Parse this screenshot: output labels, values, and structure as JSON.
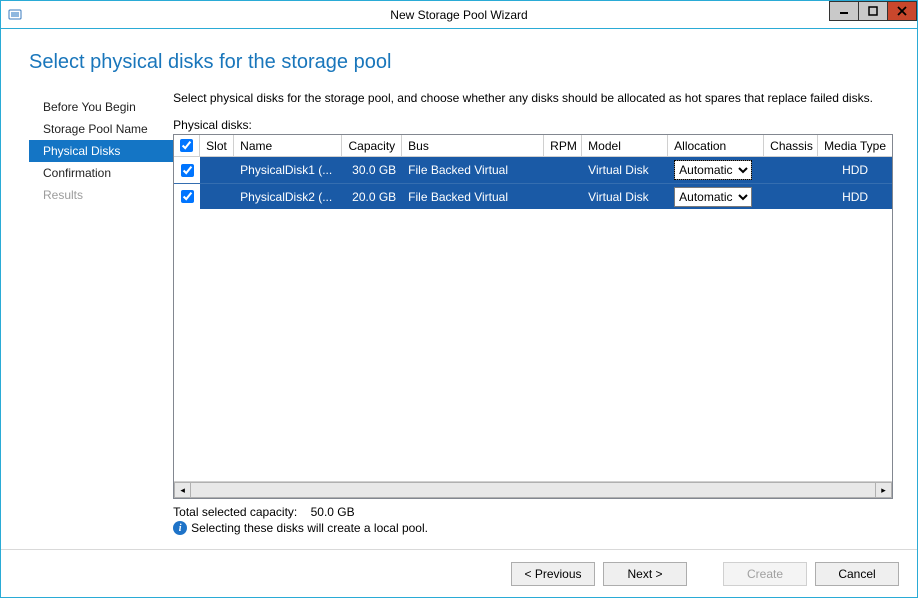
{
  "window": {
    "title": "New Storage Pool Wizard"
  },
  "page_title": "Select physical disks for the storage pool",
  "sidebar": {
    "items": [
      {
        "label": "Before You Begin",
        "active": false,
        "disabled": false
      },
      {
        "label": "Storage Pool Name",
        "active": false,
        "disabled": false
      },
      {
        "label": "Physical Disks",
        "active": true,
        "disabled": false
      },
      {
        "label": "Confirmation",
        "active": false,
        "disabled": false
      },
      {
        "label": "Results",
        "active": false,
        "disabled": true
      }
    ]
  },
  "instruction": "Select physical disks for the storage pool, and choose whether any disks should be allocated as hot spares that replace failed disks.",
  "table": {
    "label": "Physical disks:",
    "columns": [
      "",
      "Slot",
      "Name",
      "Capacity",
      "Bus",
      "RPM",
      "Model",
      "Allocation",
      "Chassis",
      "Media Type"
    ],
    "rows": [
      {
        "checked": true,
        "slot": "",
        "name": "PhysicalDisk1 (...",
        "capacity": "30.0 GB",
        "bus": "File Backed Virtual",
        "rpm": "",
        "model": "Virtual Disk",
        "allocation": "Automatic",
        "chassis": "",
        "media": "HDD"
      },
      {
        "checked": true,
        "slot": "",
        "name": "PhysicalDisk2 (...",
        "capacity": "20.0 GB",
        "bus": "File Backed Virtual",
        "rpm": "",
        "model": "Virtual Disk",
        "allocation": "Automatic",
        "chassis": "",
        "media": "HDD"
      }
    ]
  },
  "summary": {
    "capacity_label": "Total selected capacity:",
    "capacity_value": "50.0 GB",
    "info_text": "Selecting these disks will create a local pool."
  },
  "footer": {
    "previous": "< Previous",
    "next": "Next >",
    "create": "Create",
    "cancel": "Cancel"
  }
}
